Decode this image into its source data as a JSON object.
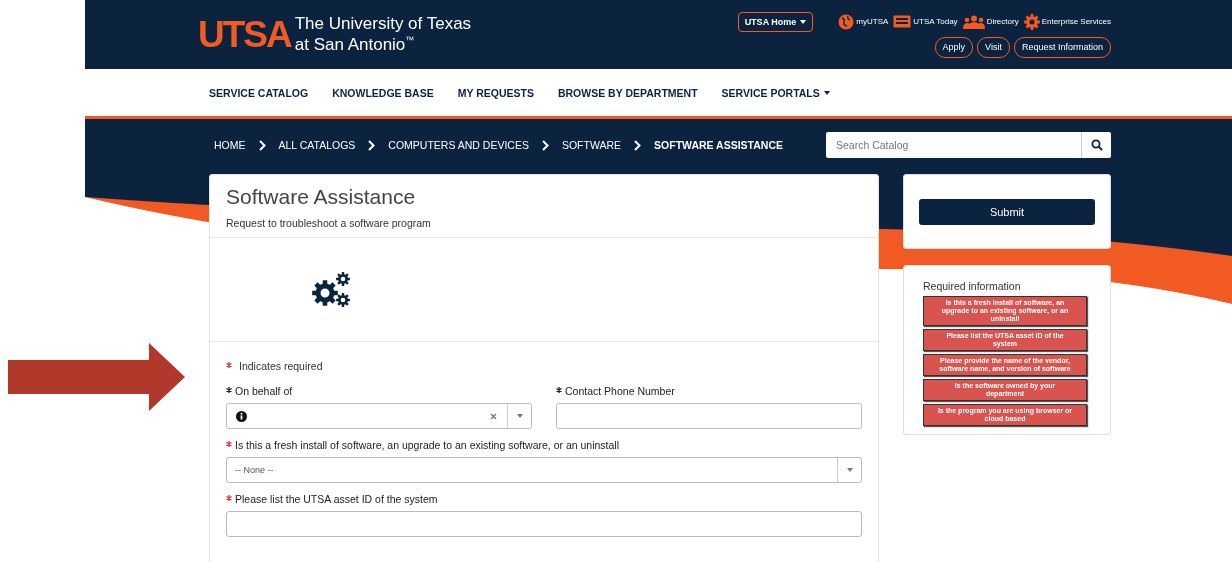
{
  "header": {
    "logo_mark": "UTSA",
    "logo_lines": [
      "The University of Texas",
      "at San Antonio$^{™}$"
    ],
    "home_menu": "UTSA Home",
    "links": [
      {
        "label": "myUTSA"
      },
      {
        "label": "UTSA Today"
      },
      {
        "label": "Directory"
      },
      {
        "label": "Enterprise Services"
      }
    ],
    "buttons": [
      "Apply",
      "Visit",
      "Request Information"
    ]
  },
  "nav": [
    {
      "label": "SERVICE CATALOG",
      "has_menu": false
    },
    {
      "label": "KNOWLEDGE BASE",
      "has_menu": false
    },
    {
      "label": "MY REQUESTS",
      "has_menu": false
    },
    {
      "label": "BROWSE BY DEPARTMENT",
      "has_menu": false
    },
    {
      "label": "SERVICE PORTALS",
      "has_menu": true
    }
  ],
  "breadcrumb": [
    {
      "label": "HOME",
      "current": false
    },
    {
      "label": "ALL CATALOGS",
      "current": false
    },
    {
      "label": "COMPUTERS AND DEVICES",
      "current": false
    },
    {
      "label": "SOFTWARE",
      "current": false
    },
    {
      "label": "SOFTWARE ASSISTANCE",
      "current": true
    }
  ],
  "search": {
    "placeholder": "Search Catalog"
  },
  "form": {
    "title": "Software Assistance",
    "subtitle": "Request to troubleshoot a software program",
    "required_note": "Indicates required",
    "rows": [
      [
        {
          "label": "On behalf of",
          "kind": "lookup",
          "satisfied": true
        },
        {
          "label": "Contact Phone Number",
          "kind": "text",
          "satisfied": true
        }
      ],
      [
        {
          "label": "Is this a fresh install of software, an upgrade to an existing software, or an uninstall",
          "kind": "select",
          "satisfied": false,
          "value": "-- None --"
        }
      ],
      [
        {
          "label": "Please list the UTSA asset ID of the system",
          "kind": "text",
          "satisfied": false
        }
      ]
    ]
  },
  "submit": "Submit",
  "required_info": {
    "title": "Required information",
    "items": [
      "Is this a fresh install of software, an upgrade to an existing software, or an uninstall",
      "Please list the UTSA asset ID of the system",
      "Please provide the name of the vendor, software name, and version of software",
      "Is the software owned by your department",
      "Is the program you are using browser or cloud based"
    ]
  }
}
